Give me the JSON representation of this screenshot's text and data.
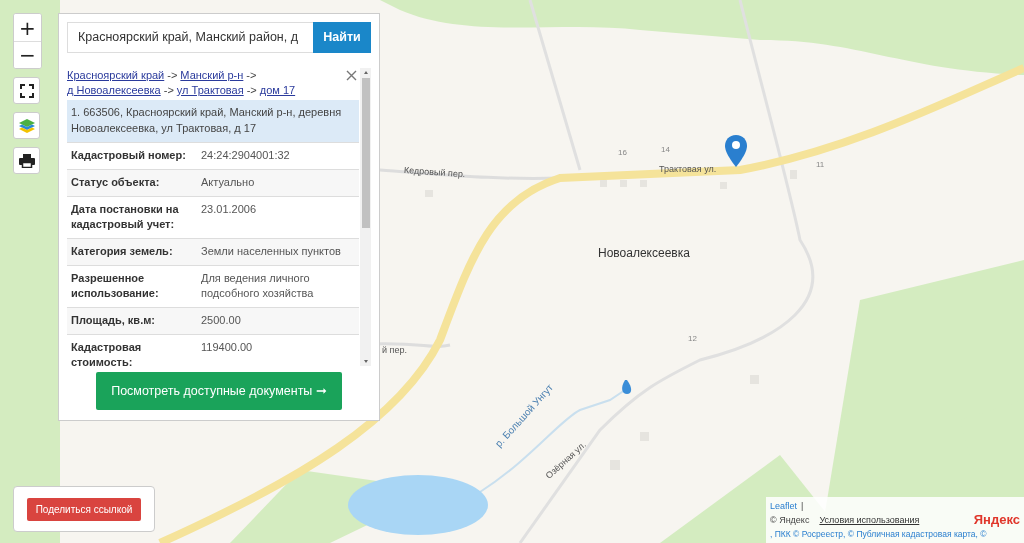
{
  "map_controls": {
    "zoom_in": "+",
    "zoom_out": "−"
  },
  "search": {
    "value": "Красноярский край, Манский район, д",
    "button": "Найти"
  },
  "breadcrumbs": [
    {
      "kind": "link",
      "text": "Красноярский край"
    },
    {
      "kind": "separator",
      "text": "->"
    },
    {
      "kind": "link",
      "text": "Манский р-н"
    },
    {
      "kind": "separator",
      "text": "->"
    },
    {
      "kind": "link",
      "text": "д Новоалексеевка"
    },
    {
      "kind": "separator",
      "text": "->"
    },
    {
      "kind": "link",
      "text": "ул Трактовая"
    },
    {
      "kind": "separator",
      "text": "->"
    },
    {
      "kind": "link",
      "text": "дом 17"
    }
  ],
  "result": {
    "text": "1. 663506, Красноярский край, Манский р-н, деревня Новоалексеевка, ул Трактовая, д 17"
  },
  "details": [
    {
      "label": "Кадастровый номер:",
      "value": "24:24:2904001:32"
    },
    {
      "label": "Статус объекта:",
      "value": "Актуально"
    },
    {
      "label": "Дата постановки на кадастровый учет:",
      "value": "23.01.2006"
    },
    {
      "label": "Категория земель:",
      "value": "Земли населенных пунктов"
    },
    {
      "label": "Разрешенное использование:",
      "value": "Для ведения личного подсобного хозяйства"
    },
    {
      "label": "Площадь, кв.м:",
      "value": "2500.00"
    },
    {
      "label": "Кадастровая стоимость:",
      "value": "119400.00"
    }
  ],
  "docs_button": "Посмотреть доступные документы ➞",
  "share_button": "Поделиться ссылкой",
  "map_labels": [
    {
      "kind": "street",
      "text": "Кедровый пер."
    },
    {
      "kind": "street",
      "text": "Трактовая ул."
    },
    {
      "kind": "house",
      "text": "16"
    },
    {
      "kind": "house",
      "text": "14"
    },
    {
      "kind": "house",
      "text": "11"
    },
    {
      "kind": "place",
      "text": "Новоалексеевка"
    },
    {
      "kind": "street",
      "text": "й пер."
    },
    {
      "kind": "house",
      "text": "12"
    },
    {
      "kind": "river",
      "text": "р. Большой Унгут"
    },
    {
      "kind": "street",
      "text": "Озёрная ул."
    }
  ],
  "attribution": {
    "leaflet": "Leaflet",
    "divider": "|",
    "copyright": "© Яндекс",
    "terms": "Условия использования",
    "logo": "Яндекс",
    "sources": ", ПКК © Росреестр, © Публичная кадастровая карта, ©"
  }
}
